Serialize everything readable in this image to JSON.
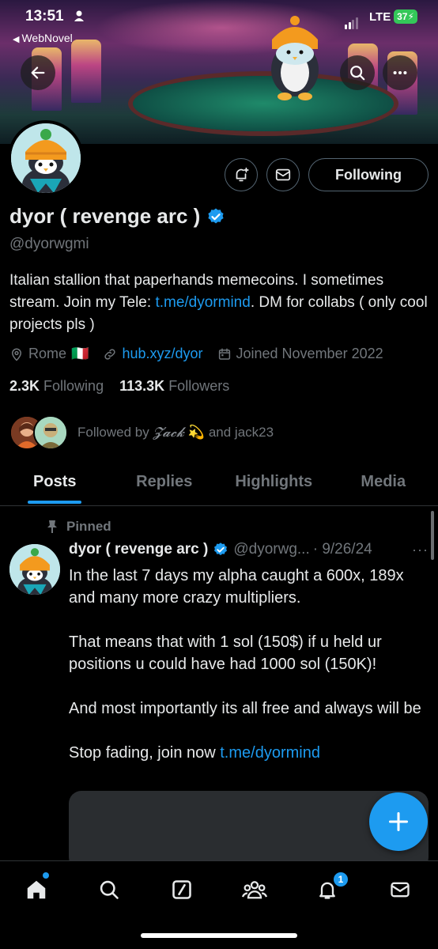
{
  "status_bar": {
    "time": "13:51",
    "back_app": "WebNovel",
    "network": "LTE",
    "battery": "37"
  },
  "profile": {
    "name": "dyor ( revenge arc )",
    "handle": "@dyorwgmi",
    "follow_label": "Following",
    "bio_text": "Italian stallion that paperhands memecoins. I sometimes stream. Join my Tele: ",
    "bio_link": "t.me/dyormind",
    "bio_tail": ". DM for collabs ( only cool projects pls )",
    "location": "Rome",
    "location_flag": "🇮🇹",
    "website": "hub.xyz/dyor",
    "joined": "Joined November 2022",
    "following_count": "2.3K",
    "following_label": "Following",
    "followers_count": "113.3K",
    "followers_label": "Followers",
    "followed_by_prefix": "Followed by",
    "followed_by_name1": "𝓩𝓪𝓬𝓴",
    "followed_by_emoji": "💫",
    "followed_by_mid": "and",
    "followed_by_name2": "jack23"
  },
  "tabs": [
    {
      "label": "Posts",
      "active": true
    },
    {
      "label": "Replies"
    },
    {
      "label": "Highlights"
    },
    {
      "label": "Media"
    }
  ],
  "post": {
    "pinned_label": "Pinned",
    "author_name": "dyor ( revenge arc )",
    "author_handle": "@dyorwg...",
    "date": "· 9/26/24",
    "more": "···",
    "para1": "In the last 7 days my alpha caught a 600x, 189x and many more crazy multipliers.",
    "para2": "That means that with 1 sol (150$) if u held ur positions u could have had 1000 sol (150K)!",
    "para3": "And most importantly its all free and always will be",
    "para4_text": "Stop fading, join now ",
    "para4_link": "t.me/dyormind"
  },
  "notifications_badge": "1",
  "colors": {
    "accent": "#1d9bf0",
    "background": "#000000",
    "muted": "#71767b",
    "verified": "#1d9bf0"
  },
  "icons": [
    "back-arrow-icon",
    "search-icon",
    "more-icon",
    "bell-add-icon",
    "mail-icon",
    "verified-icon",
    "location-icon",
    "link-icon",
    "calendar-icon",
    "pin-icon",
    "home-icon",
    "grok-icon",
    "communities-icon",
    "notifications-icon",
    "messages-icon",
    "compose-plus-icon"
  ]
}
